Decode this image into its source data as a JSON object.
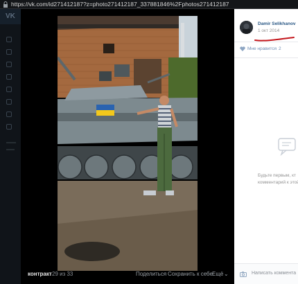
{
  "browser": {
    "url": "https://vk.com/id271412187?z=photo271412187_337881846%2Fphotos271412187"
  },
  "viewer": {
    "album": "контракт",
    "counter": "29 из 33",
    "actions": [
      "Поделиться",
      "Сохранить к себе",
      "Ещё"
    ],
    "more_arrow": "⌄"
  },
  "panel": {
    "author": "Damir Selikhanov",
    "date": "1 окт 2014",
    "like_label": "Мне нравится",
    "like_count": "2",
    "empty_line1": "Будьте первым, кт",
    "empty_line2": "комментарий к этой",
    "comment_placeholder": "Написать коммента",
    "accent": "#2a5885",
    "underline_color": "#c4161c"
  }
}
